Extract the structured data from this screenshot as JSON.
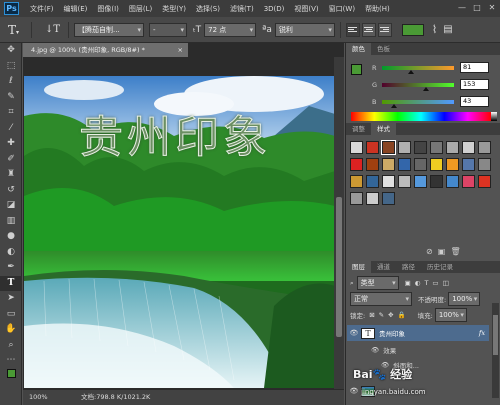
{
  "app": {
    "logo": "Ps"
  },
  "menu": [
    "文件(F)",
    "编辑(E)",
    "图像(I)",
    "图层(L)",
    "类型(Y)",
    "选择(S)",
    "滤镜(T)",
    "3D(D)",
    "视图(V)",
    "窗口(W)",
    "帮助(H)"
  ],
  "window_controls": [
    "—",
    "□",
    "✕"
  ],
  "options_bar": {
    "font_family": "【腾茄自制...",
    "font_style": "-",
    "font_size": "72 点",
    "anti_alias": "锐利",
    "text_color": "#4a9a35"
  },
  "tools": [
    "move-tool-icon",
    "marquee-tool-icon",
    "lasso-tool-icon",
    "quick-select-icon",
    "crop-tool-icon",
    "eyedropper-icon",
    "healing-brush-icon",
    "brush-tool-icon",
    "clone-stamp-icon",
    "history-brush-icon",
    "eraser-icon",
    "gradient-tool-icon",
    "blur-tool-icon",
    "dodge-tool-icon",
    "pen-tool-icon",
    "type-tool-icon",
    "path-select-icon",
    "shape-tool-icon",
    "hand-tool-icon",
    "zoom-tool-icon"
  ],
  "document": {
    "tab_title": "4.jpg @ 100% (贵州印象, RGB/8#) *",
    "canvas_text": "贵州印象"
  },
  "status": {
    "zoom": "100%",
    "doc_info": "文档:798.8 K/1021.2K"
  },
  "color_panel": {
    "tabs": [
      "颜色",
      "色板"
    ],
    "r_label": "R",
    "g_label": "G",
    "b_label": "B",
    "r": "81",
    "g": "153",
    "b": "43",
    "foreground": "#4a9a35",
    "background": "#ffffff"
  },
  "styles_panel": {
    "tabs": [
      "调整",
      "样式"
    ],
    "swatches": [
      "#d9d9d9",
      "#cc3322",
      "#884422",
      "#b0b0b0",
      "#444444",
      "#777777",
      "#aaaaaa",
      "#d0d0d0",
      "#999999",
      "#dd2222",
      "#a04010",
      "#ccaa66",
      "#3366aa",
      "#666666",
      "#eecc22",
      "#ee9922",
      "#5577aa",
      "#888888",
      "#cc9933",
      "#336699",
      "#e0e0e0",
      "#bbbbbb",
      "#5599dd",
      "#333333",
      "#4488cc",
      "#dd4466",
      "#dd3322",
      "#999999",
      "#cccccc",
      "#446688"
    ]
  },
  "layers_panel": {
    "tabs": [
      "图层",
      "通道",
      "路径",
      "历史记录"
    ],
    "kind_filter": "类型",
    "blend_mode": "正常",
    "opacity_label": "不透明度:",
    "opacity": "100%",
    "lock_label": "锁定:",
    "fill_label": "填充:",
    "fill": "100%",
    "layers": [
      {
        "name": "贵州印象",
        "type": "text",
        "fx": "fx"
      },
      {
        "name": "效果"
      },
      {
        "name": "斜面和..."
      }
    ]
  },
  "watermark": {
    "text": "Bai🐾 经验",
    "url": "jingyan.baidu.com"
  }
}
